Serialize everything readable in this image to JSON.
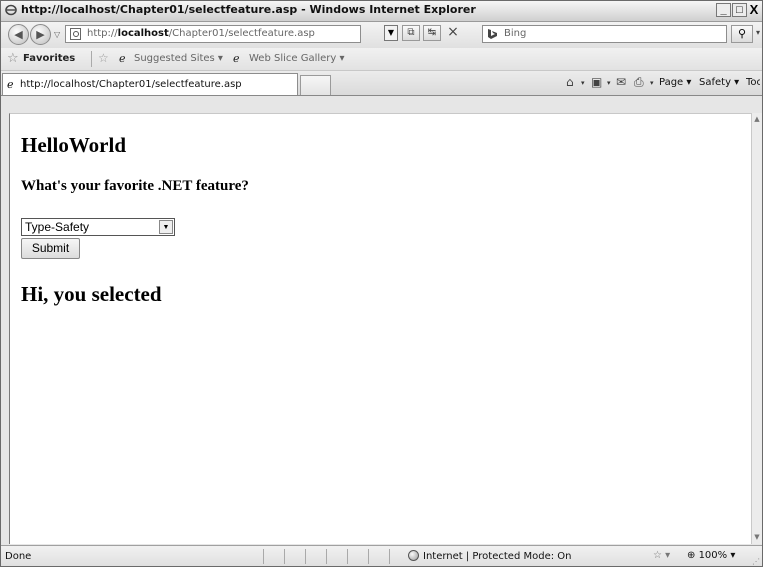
{
  "window": {
    "title": "http://localhost/Chapter01/selectfeature.asp - Windows Internet Explorer",
    "buttons": {
      "minimize": "_",
      "maximize": "□",
      "close": "X"
    }
  },
  "navbar": {
    "url_prefix": "http://",
    "url_host": "localhost",
    "url_path": "/Chapter01/selectfeature.asp",
    "search_placeholder": "Bing"
  },
  "favorites_bar": {
    "favorites_label": "Favorites",
    "suggested_sites_label": "Suggested Sites ▾",
    "web_slice_label": "Web Slice Gallery ▾"
  },
  "tabs": [
    {
      "label": "http://localhost/Chapter01/selectfeature.asp"
    }
  ],
  "command_bar": {
    "page_label": "Page ▾",
    "safety_label": "Safety ▾",
    "tools_label": "Tools ▾"
  },
  "page": {
    "heading": "HelloWorld",
    "question": "What's your favorite .NET feature?",
    "select_value": "Type-Safety",
    "submit_label": "Submit",
    "result_text": "Hi, you selected"
  },
  "status_bar": {
    "status": "Done",
    "zone": "Internet | Protected Mode: On",
    "zoom": "100%"
  }
}
